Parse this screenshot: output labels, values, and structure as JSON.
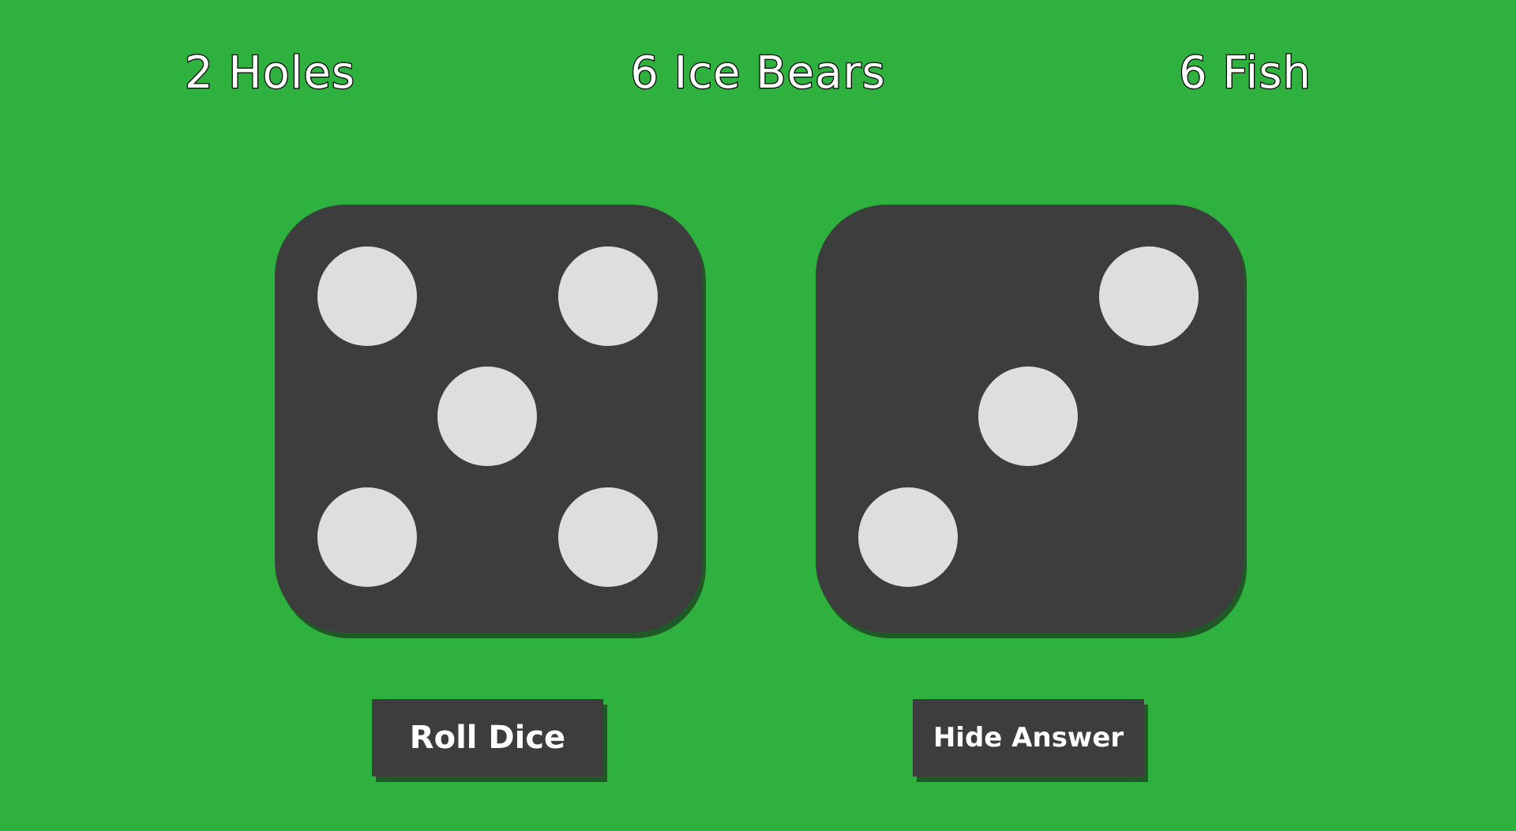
{
  "answers": {
    "holes": "2 Holes",
    "ice_bears": "6 Ice Bears",
    "fish": "6 Fish"
  },
  "dice": [
    {
      "value": 5
    },
    {
      "value": 3
    }
  ],
  "buttons": {
    "roll_label": "Roll Dice",
    "hide_label": "Hide Answer"
  },
  "colors": {
    "background": "#2fb13f",
    "die_face": "#3d3d3d",
    "pip": "#dedede",
    "shadow": "#1f5a26"
  }
}
